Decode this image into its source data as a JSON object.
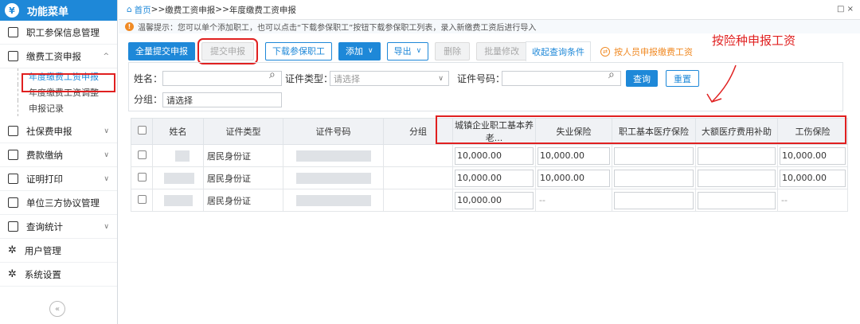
{
  "sidebar": {
    "title": "功能菜单",
    "logo_glyph": "¥",
    "items": [
      {
        "label": "职工参保信息管理"
      },
      {
        "label": "缴费工资申报"
      },
      {
        "label": "社保费申报"
      },
      {
        "label": "费款缴纳"
      },
      {
        "label": "证明打印"
      },
      {
        "label": "单位三方协议管理"
      },
      {
        "label": "查询统计"
      },
      {
        "label": "用户管理"
      },
      {
        "label": "系统设置"
      }
    ],
    "subitems": [
      {
        "label": "年度缴费工资申报"
      },
      {
        "label": "年度缴费工资调整"
      },
      {
        "label": "申报记录"
      }
    ],
    "collapse_glyph": "«"
  },
  "topbar": {
    "home": "首页",
    "sep1": " >> ",
    "crumb1": "缴费工资申报",
    "sep2": " >> ",
    "crumb2": "年度缴费工资申报",
    "controls": "□ ×"
  },
  "tip": {
    "icon": "!",
    "text": "温馨提示：您可以单个添加职工，也可以点击“下载参保职工”按钮下载参保职工列表，录入新缴费工资后进行导入"
  },
  "toolbar": {
    "submit_all": "全量提交申报",
    "submit": "提交申报",
    "download": "下载参保职工",
    "add": "添加",
    "add_chev": "∨",
    "export": "导出",
    "export_chev": "∨",
    "delete": "删除",
    "batch_edit": "批量修改",
    "collapse_query": "收起查询条件",
    "by_person": "按人员申报缴费工资",
    "by_person_icon": "⇄"
  },
  "annotation": {
    "text": "按险种申报工资"
  },
  "search": {
    "name_label": "姓名：",
    "name_value": "",
    "cert_type_label": "证件类型：",
    "cert_type_placeholder": "请选择",
    "cert_no_label": "证件号码：",
    "cert_no_value": "",
    "group_label": "分组：",
    "group_placeholder": "请选择",
    "query": "查询",
    "reset": "重置",
    "search_glyph": "⌕",
    "select_chev": "∨"
  },
  "table": {
    "headers": [
      "姓名",
      "证件类型",
      "证件号码",
      "分组",
      "城镇企业职工基本养老...",
      "失业保险",
      "职工基本医疗保险",
      "大额医疗费用补助",
      "工伤保险"
    ],
    "rows": [
      {
        "cert_type": "居民身份证",
        "pension": "10,000.00",
        "unemployment": "10,000.00",
        "medical": "",
        "large_medical": "",
        "injury": "10,000.00"
      },
      {
        "cert_type": "居民身份证",
        "pension": "10,000.00",
        "unemployment": "10,000.00",
        "medical": "",
        "large_medical": "",
        "injury": "10,000.00"
      },
      {
        "cert_type": "居民身份证",
        "pension": "10,000.00",
        "unemployment": "--",
        "medical": "",
        "large_medical": "",
        "injury": "--"
      }
    ]
  }
}
